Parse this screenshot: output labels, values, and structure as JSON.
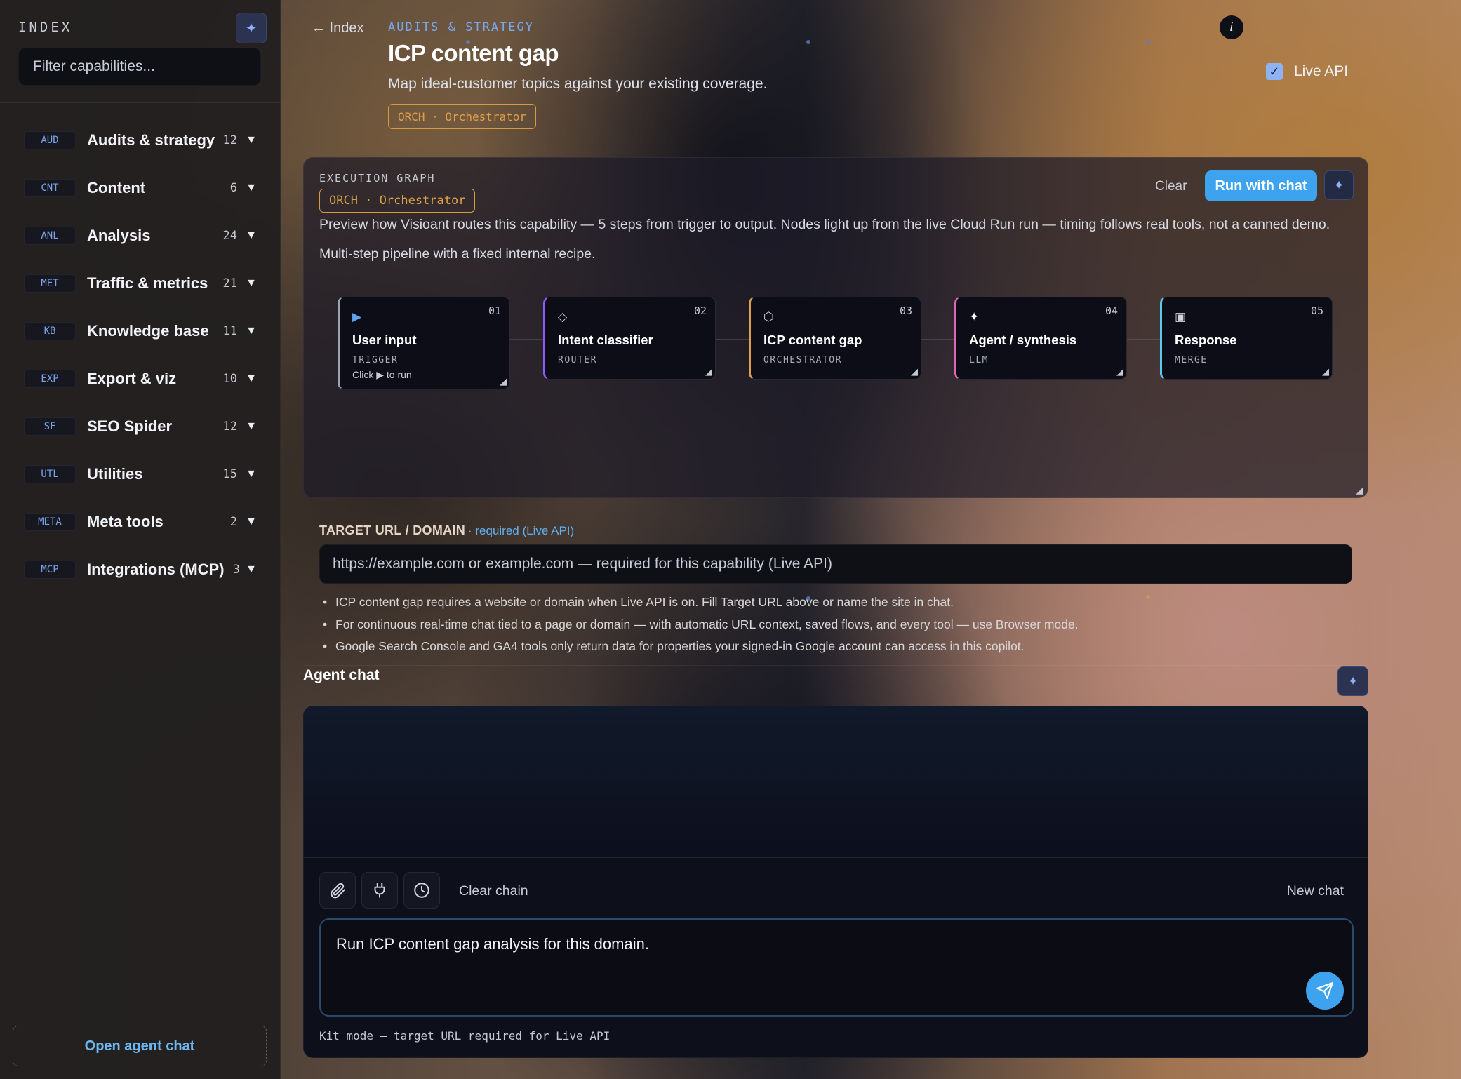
{
  "colors": {
    "accent": "#3ea3ee",
    "orchestrator": "#e0a04a",
    "badge_text": "#7aa2e8",
    "trigger": "#9aa3b2",
    "router": "#8b5cf6",
    "orchestrator_node": "#e0a04a",
    "llm": "#e067b8",
    "merge": "#5ec6f0"
  },
  "sidebar": {
    "heading": "INDEX",
    "spark_icon": "sparkle-icon",
    "filter_placeholder": "Filter capabilities...",
    "items": [
      {
        "badge": "AUD",
        "label": "Audits & strategy",
        "count": "12"
      },
      {
        "badge": "CNT",
        "label": "Content",
        "count": "6"
      },
      {
        "badge": "ANL",
        "label": "Analysis",
        "count": "24"
      },
      {
        "badge": "MET",
        "label": "Traffic & metrics",
        "count": "21"
      },
      {
        "badge": "KB",
        "label": "Knowledge base",
        "count": "11"
      },
      {
        "badge": "EXP",
        "label": "Export & viz",
        "count": "10"
      },
      {
        "badge": "SF",
        "label": "SEO Spider",
        "count": "12"
      },
      {
        "badge": "UTL",
        "label": "Utilities",
        "count": "15"
      },
      {
        "badge": "META",
        "label": "Meta tools",
        "count": "2"
      },
      {
        "badge": "MCP",
        "label": "Integrations (MCP)",
        "count": "3"
      }
    ],
    "caret": "▼",
    "open_chat_label": "Open agent chat"
  },
  "header": {
    "back_label": "← Index",
    "eyebrow": "AUDITS & STRATEGY",
    "title": "ICP content gap",
    "subtitle": "Map ideal-customer topics against your existing coverage.",
    "tag": "ORCH · Orchestrator",
    "info_glyph": "i",
    "live_api_label": "Live API",
    "live_api_checked": true
  },
  "graph": {
    "eyebrow": "EXECUTION GRAPH",
    "tag": "ORCH · Orchestrator",
    "clear_label": "Clear",
    "run_label": "Run with chat",
    "description": "Preview how Visioant routes this capability — 5 steps from trigger to output. Nodes light up from the live Cloud Run run — timing follows real tools, not a canned demo.",
    "note": "Multi-step pipeline with a fixed internal recipe.",
    "nodes": [
      {
        "num": "01",
        "icon": "▶",
        "icon_name": "play-icon",
        "name": "User input",
        "type": "TRIGGER",
        "hint": "Click ▶ to run"
      },
      {
        "num": "02",
        "icon": "◇",
        "icon_name": "diamond-icon",
        "name": "Intent classifier",
        "type": "ROUTER"
      },
      {
        "num": "03",
        "icon": "⬡",
        "icon_name": "hexagon-icon",
        "name": "ICP content gap",
        "type": "ORCHESTRATOR"
      },
      {
        "num": "04",
        "icon": "✦",
        "icon_name": "sparkle-icon",
        "name": "Agent / synthesis",
        "type": "LLM"
      },
      {
        "num": "05",
        "icon": "▣",
        "icon_name": "square-icon",
        "name": "Response",
        "type": "MERGE"
      }
    ]
  },
  "target": {
    "label": "TARGET URL / DOMAIN",
    "required_label": "· required (Live API)",
    "placeholder": "https://example.com or example.com — required for this capability (Live API)",
    "notes": [
      "ICP content gap requires a website or domain when Live API is on. Fill Target URL above or name the site in chat.",
      "For continuous real-time chat tied to a page or domain — with automatic URL context, saved flows, and every tool — use Browser mode.",
      "Google Search Console and GA4 tools only return data for properties your signed-in Google account can access in this copilot."
    ]
  },
  "chat": {
    "title": "Agent chat",
    "clear_chain_label": "Clear chain",
    "new_chat_label": "New chat",
    "composer_value": "Run ICP content gap analysis for this domain.",
    "footer": "Kit mode — target URL required for Live API",
    "toolbar_icons": [
      "paperclip-icon",
      "plug-icon",
      "clock-icon"
    ]
  }
}
